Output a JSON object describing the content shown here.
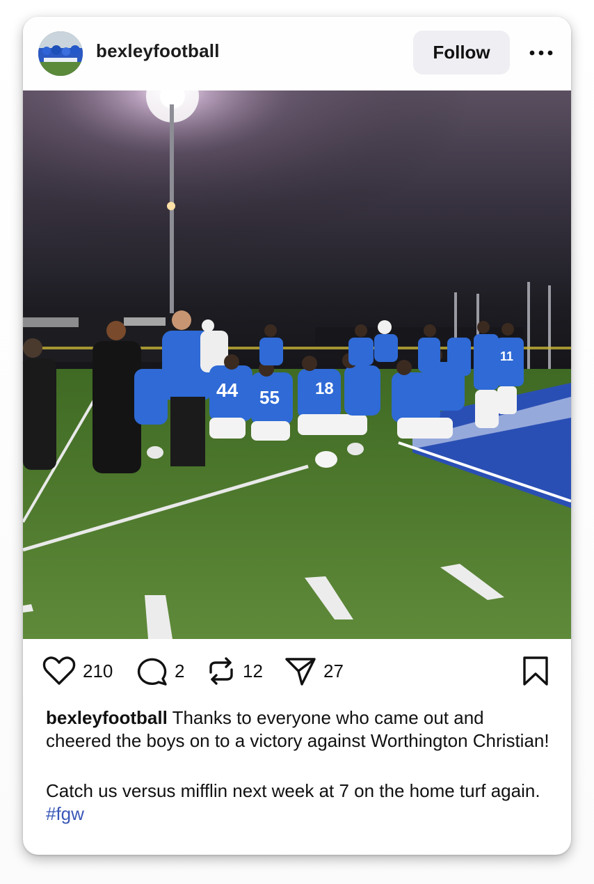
{
  "post": {
    "username": "bexleyfootball",
    "follow_label": "Follow",
    "more_icon": "more-horizontal-icon",
    "photo_alt": "Football team kneeling on the field at night after the game",
    "actions": {
      "likes": "210",
      "comments": "2",
      "reposts": "12",
      "shares": "27"
    },
    "caption": {
      "username": "bexleyfootball",
      "text": "Thanks to everyone who came out and cheered the boys on to a victory against Worthington Christian!",
      "text2": "Catch us versus mifflin next week at 7 on the home turf again.",
      "hashtag": "#fgw"
    },
    "colors": {
      "hashtag": "#3a57b7",
      "jersey": "#2f6ad6",
      "turf": "#4f7a2e",
      "follow_bg": "#eeeef3"
    },
    "jersey_numbers": [
      "44",
      "55",
      "18",
      "11"
    ]
  }
}
